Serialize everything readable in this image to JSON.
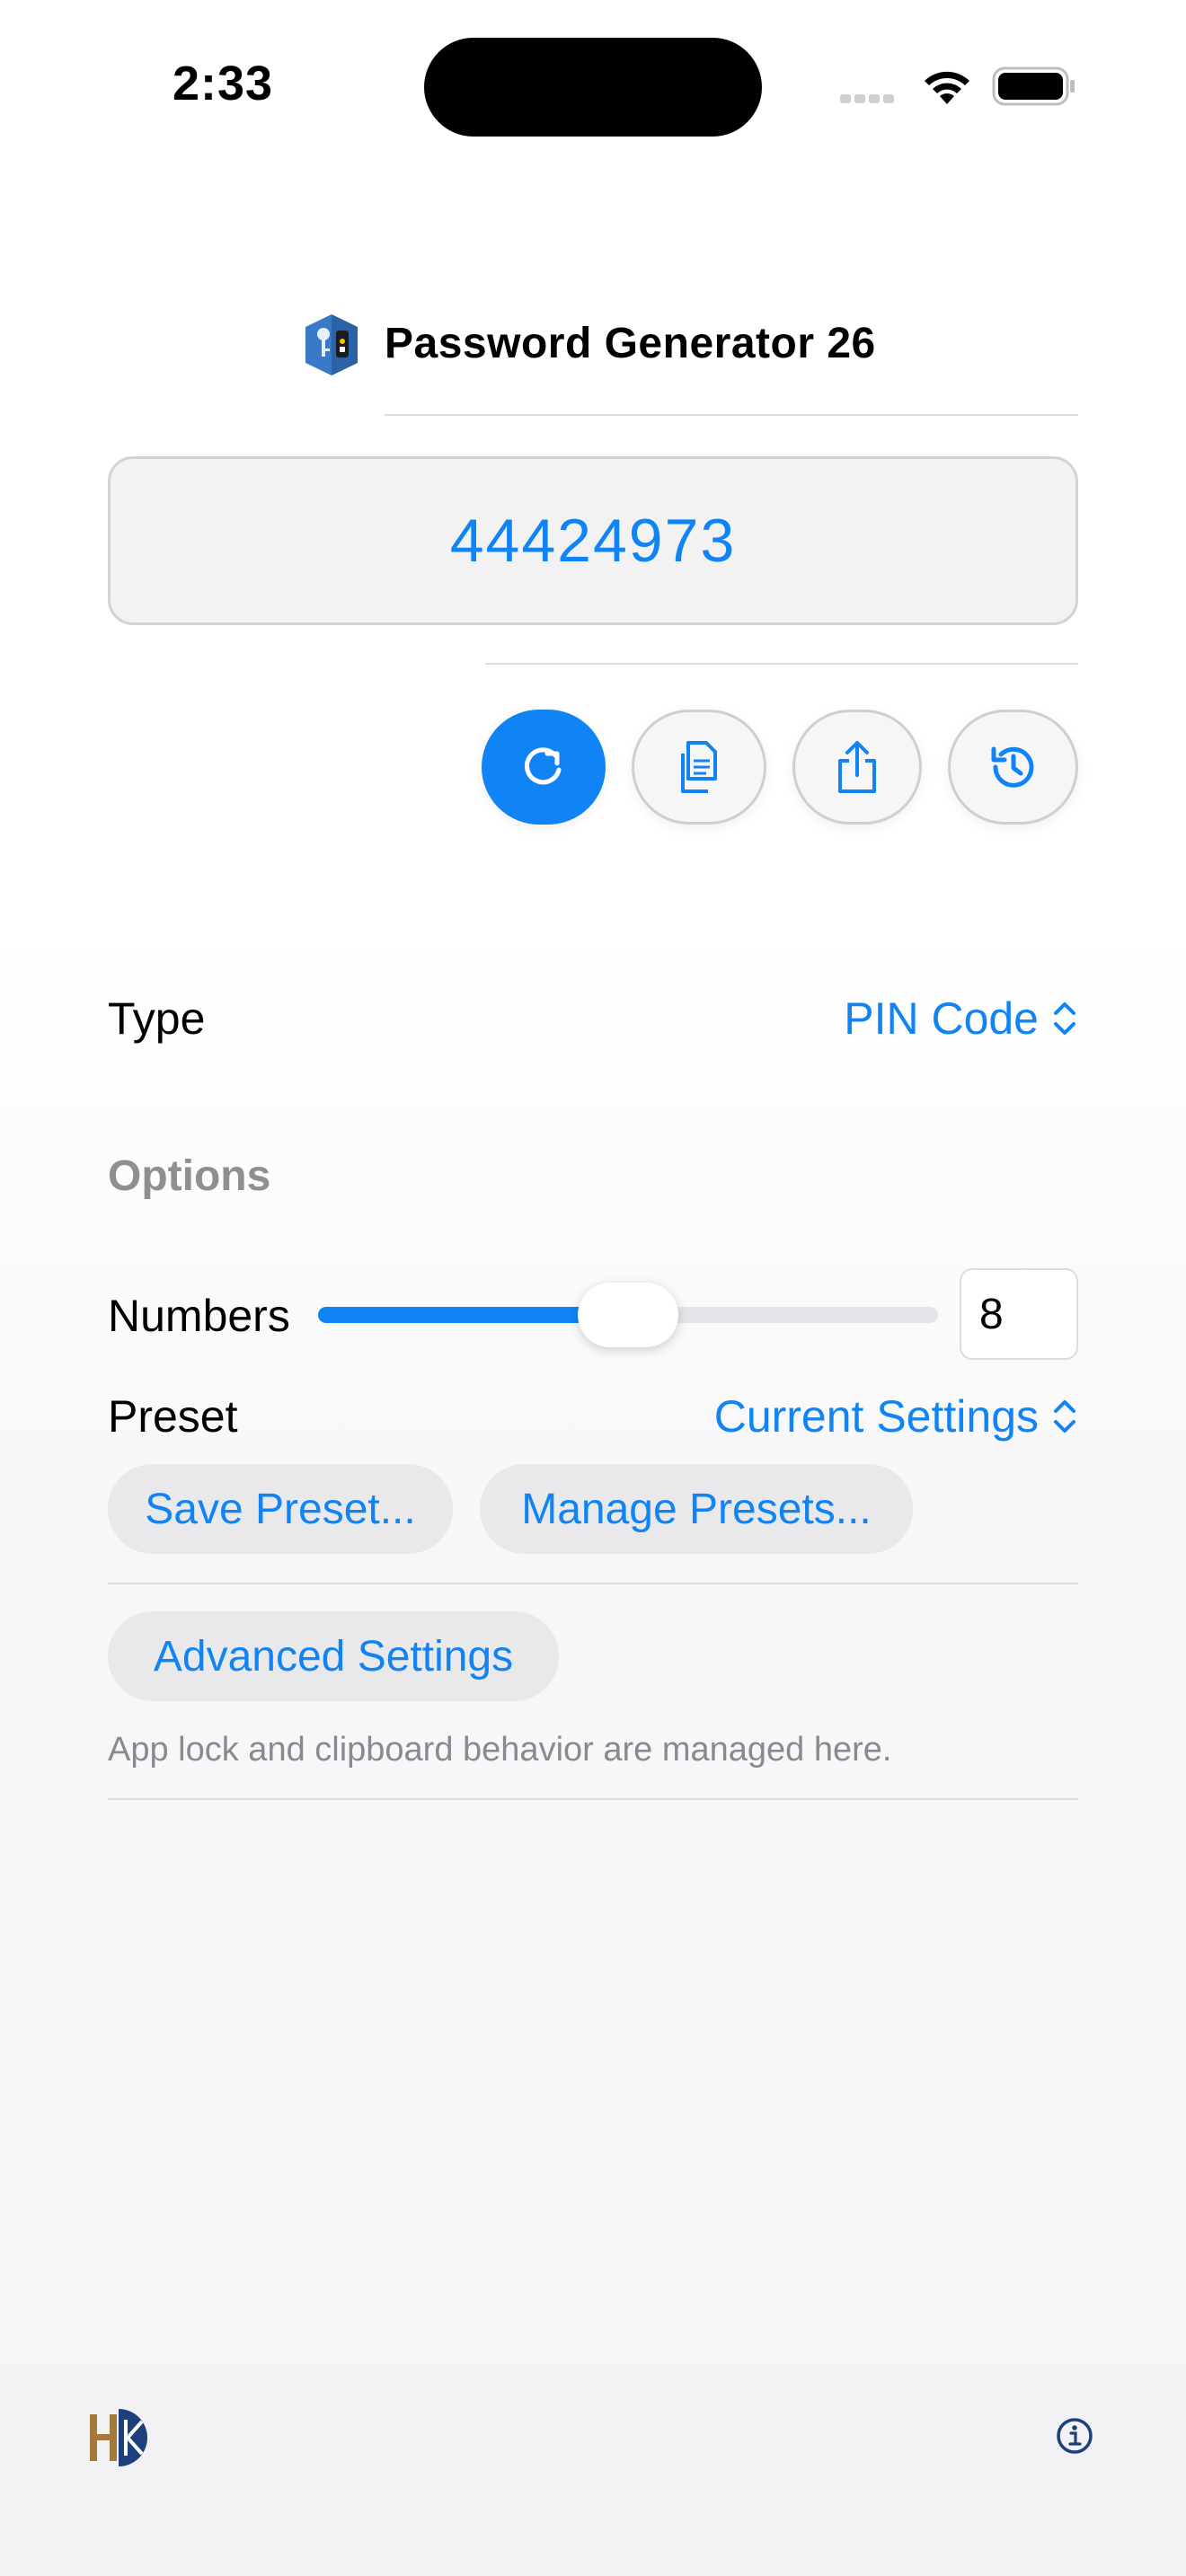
{
  "status_bar": {
    "time": "2:33"
  },
  "header": {
    "app_icon": "key-lock-app-icon",
    "title": "Password Generator 26"
  },
  "password": {
    "value": "44424973"
  },
  "actions": [
    {
      "name": "regenerate",
      "icon": "refresh-icon"
    },
    {
      "name": "copy",
      "icon": "copy-icon"
    },
    {
      "name": "share",
      "icon": "share-icon"
    },
    {
      "name": "history",
      "icon": "history-icon"
    }
  ],
  "type_row": {
    "label": "Type",
    "value": "PIN Code"
  },
  "options": {
    "heading": "Options",
    "numbers": {
      "label": "Numbers",
      "value": "8",
      "slider_fraction": 0.5
    },
    "preset": {
      "label": "Preset",
      "value": "Current Settings"
    },
    "save_preset": "Save Preset...",
    "manage_presets": "Manage Presets...",
    "advanced_settings": "Advanced Settings",
    "footnote": "App lock and clipboard behavior are managed here."
  },
  "footer": {
    "logo": "hk-logo",
    "info_icon": "info-icon"
  },
  "colors": {
    "accent": "#1084f4",
    "secondary_text": "#8e8e93"
  }
}
